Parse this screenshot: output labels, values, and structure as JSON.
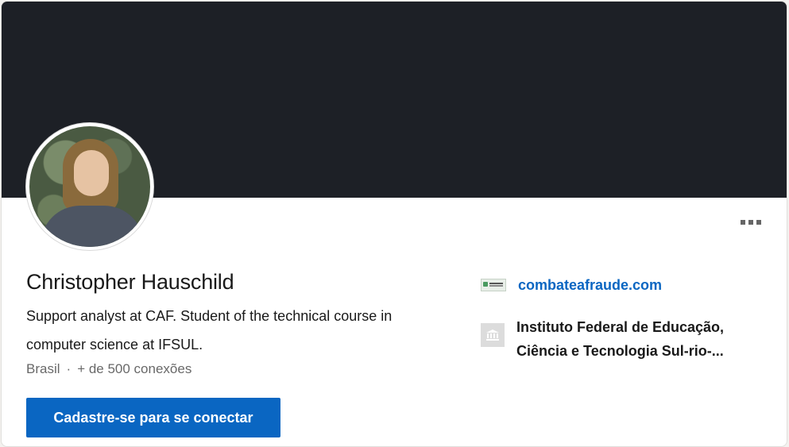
{
  "profile": {
    "name": "Christopher Hauschild",
    "headline": "Support analyst at CAF. Student of the technical course in computer science at IFSUL.",
    "location": "Brasil",
    "separator": "·",
    "connections": "+ de 500 conexões",
    "connect_label": "Cadastre-se para se conectar"
  },
  "sidebar": {
    "website": "combateafraude.com",
    "school_line1": "Instituto Federal de Educação,",
    "school_line2": "Ciência e Tecnologia Sul-rio-..."
  },
  "icons": {
    "more": "more-horizontal-icon",
    "company": "company-logo",
    "school": "school-building-icon"
  },
  "colors": {
    "cover": "#1d2026",
    "primary": "#0a66c2"
  }
}
